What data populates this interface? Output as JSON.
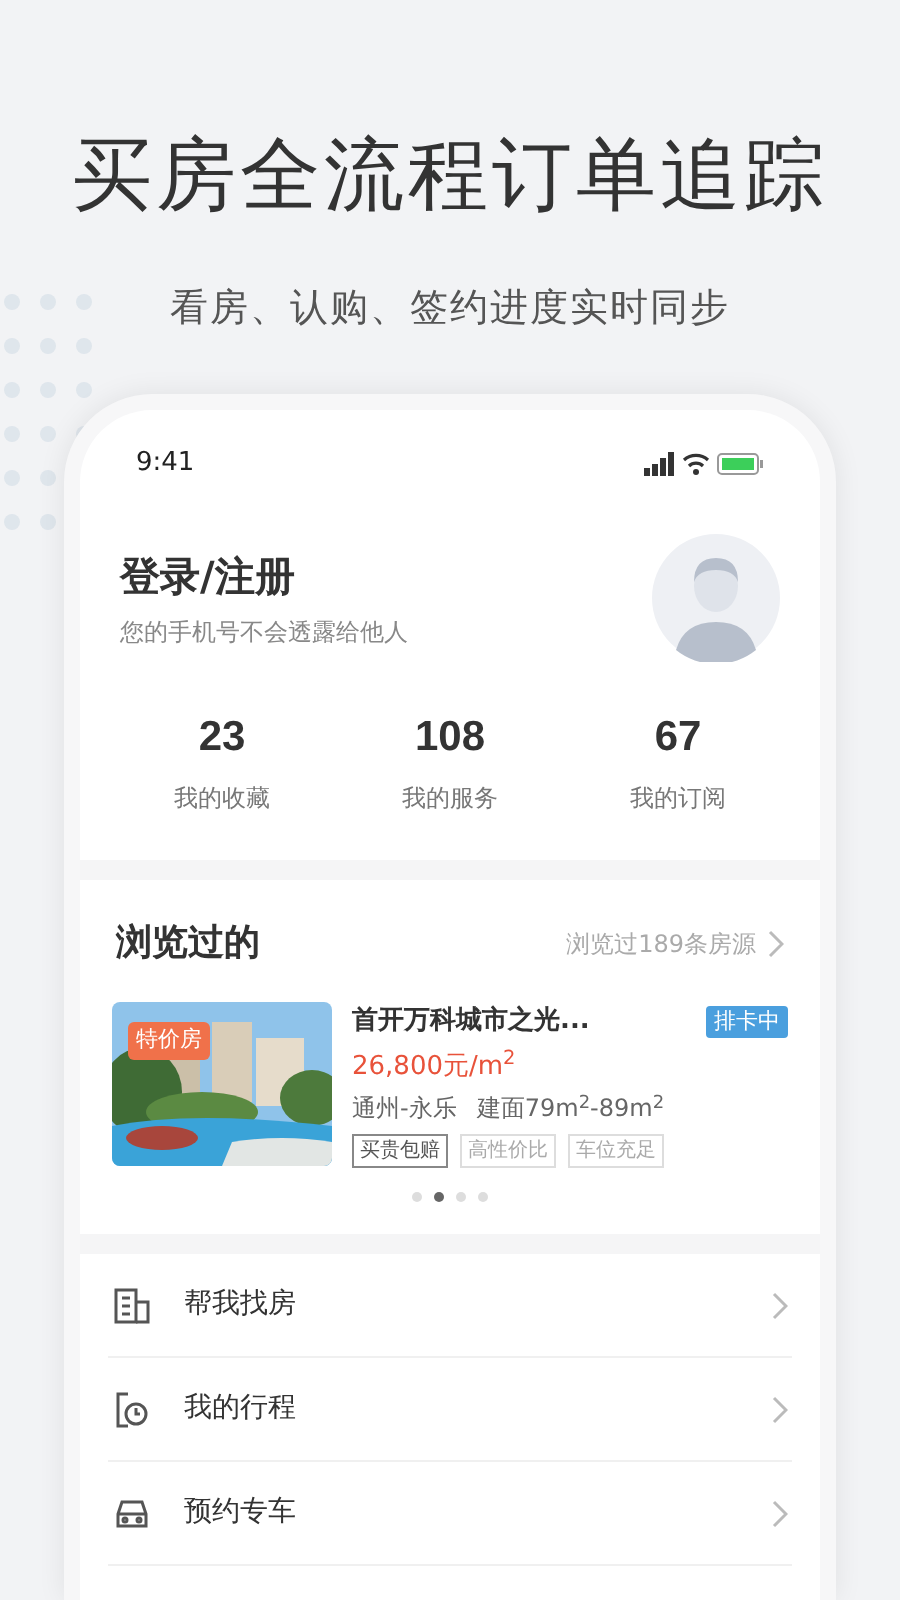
{
  "headline": "买房全流程订单追踪",
  "subtitle": "看房、认购、签约进度实时同步",
  "status_bar": {
    "time": "9:41"
  },
  "profile": {
    "title": "登录/注册",
    "note": "您的手机号不会透露给他人"
  },
  "stats": [
    {
      "value": "23",
      "label": "我的收藏"
    },
    {
      "value": "108",
      "label": "我的服务"
    },
    {
      "value": "67",
      "label": "我的订阅"
    }
  ],
  "browsed": {
    "title": "浏览过的",
    "more": "浏览过189条房源",
    "listing": {
      "badge": "特价房",
      "name": "首开万科城市之光...",
      "status": "排卡中",
      "price": "26,800元/m$^{2}$",
      "location": "通州-永乐",
      "area": "建面79m$^{2}$-89m$^{2}$",
      "tags": [
        {
          "label": "买贵包赔",
          "emphasized": true
        },
        {
          "label": "高性价比",
          "emphasized": false
        },
        {
          "label": "车位充足",
          "emphasized": false
        }
      ]
    },
    "pager": [
      {
        "selected": false
      },
      {
        "selected": true
      },
      {
        "selected": false
      },
      {
        "selected": false
      }
    ]
  },
  "menu": [
    {
      "kind": "building",
      "label": "帮我找房"
    },
    {
      "kind": "schedule",
      "label": "我的行程"
    },
    {
      "kind": "car",
      "label": "预约专车"
    }
  ]
}
